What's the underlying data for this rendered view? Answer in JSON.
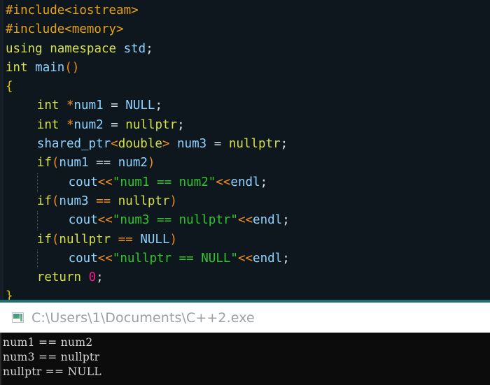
{
  "editor": {
    "background": "#0f171e",
    "lines": [
      {
        "indent": 0,
        "guide": false,
        "tokens": [
          {
            "t": "#include<iostream>",
            "c": "c-pre"
          }
        ]
      },
      {
        "indent": 0,
        "guide": false,
        "tokens": [
          {
            "t": "#include<memory>",
            "c": "c-pre"
          }
        ]
      },
      {
        "indent": 0,
        "guide": false,
        "tokens": [
          {
            "t": "using",
            "c": "c-kw"
          },
          {
            "t": " ",
            "c": "c-punc"
          },
          {
            "t": "namespace",
            "c": "c-kw"
          },
          {
            "t": " ",
            "c": "c-punc"
          },
          {
            "t": "std",
            "c": "c-id"
          },
          {
            "t": ";",
            "c": "c-punc"
          }
        ]
      },
      {
        "indent": 0,
        "guide": false,
        "tokens": [
          {
            "t": "int",
            "c": "c-kw"
          },
          {
            "t": " ",
            "c": "c-punc"
          },
          {
            "t": "main",
            "c": "c-id"
          },
          {
            "t": "()",
            "c": "c-op"
          }
        ]
      },
      {
        "indent": 0,
        "guide": false,
        "tokens": [
          {
            "t": "{",
            "c": "c-brace"
          }
        ]
      },
      {
        "indent": 4,
        "guide": false,
        "tokens": [
          {
            "t": "int",
            "c": "c-kw"
          },
          {
            "t": " ",
            "c": "c-punc"
          },
          {
            "t": "*",
            "c": "c-op"
          },
          {
            "t": "num1",
            "c": "c-id"
          },
          {
            "t": " ",
            "c": "c-punc"
          },
          {
            "t": "=",
            "c": "c-punc"
          },
          {
            "t": " ",
            "c": "c-punc"
          },
          {
            "t": "NULL",
            "c": "c-id"
          },
          {
            "t": ";",
            "c": "c-punc"
          }
        ]
      },
      {
        "indent": 4,
        "guide": false,
        "tokens": [
          {
            "t": "int",
            "c": "c-kw"
          },
          {
            "t": " ",
            "c": "c-punc"
          },
          {
            "t": "*",
            "c": "c-op"
          },
          {
            "t": "num2",
            "c": "c-id"
          },
          {
            "t": " ",
            "c": "c-punc"
          },
          {
            "t": "=",
            "c": "c-punc"
          },
          {
            "t": " ",
            "c": "c-punc"
          },
          {
            "t": "nullptr",
            "c": "c-kw"
          },
          {
            "t": ";",
            "c": "c-punc"
          }
        ]
      },
      {
        "indent": 4,
        "guide": false,
        "tokens": [
          {
            "t": "shared_ptr",
            "c": "c-id"
          },
          {
            "t": "<",
            "c": "c-op"
          },
          {
            "t": "double",
            "c": "c-kw"
          },
          {
            "t": ">",
            "c": "c-op"
          },
          {
            "t": " ",
            "c": "c-punc"
          },
          {
            "t": "num3",
            "c": "c-id"
          },
          {
            "t": " ",
            "c": "c-punc"
          },
          {
            "t": "=",
            "c": "c-punc"
          },
          {
            "t": " ",
            "c": "c-punc"
          },
          {
            "t": "nullptr",
            "c": "c-kw"
          },
          {
            "t": ";",
            "c": "c-punc"
          }
        ]
      },
      {
        "indent": 4,
        "guide": false,
        "tokens": [
          {
            "t": "if",
            "c": "c-kw"
          },
          {
            "t": "(",
            "c": "c-op"
          },
          {
            "t": "num1",
            "c": "c-id"
          },
          {
            "t": " ",
            "c": "c-punc"
          },
          {
            "t": "==",
            "c": "c-punc"
          },
          {
            "t": " ",
            "c": "c-punc"
          },
          {
            "t": "num2",
            "c": "c-id"
          },
          {
            "t": ")",
            "c": "c-op"
          }
        ]
      },
      {
        "indent": 8,
        "guide": true,
        "tokens": [
          {
            "t": "cout",
            "c": "c-id"
          },
          {
            "t": "<<",
            "c": "c-op"
          },
          {
            "t": "\"num1 == num2\"",
            "c": "c-str"
          },
          {
            "t": "<<",
            "c": "c-op"
          },
          {
            "t": "endl",
            "c": "c-id"
          },
          {
            "t": ";",
            "c": "c-punc"
          }
        ]
      },
      {
        "indent": 4,
        "guide": false,
        "tokens": [
          {
            "t": "if",
            "c": "c-kw"
          },
          {
            "t": "(",
            "c": "c-op"
          },
          {
            "t": "num3",
            "c": "c-id"
          },
          {
            "t": " ",
            "c": "c-punc"
          },
          {
            "t": "==",
            "c": "c-op"
          },
          {
            "t": " ",
            "c": "c-punc"
          },
          {
            "t": "nullptr",
            "c": "c-kw"
          },
          {
            "t": ")",
            "c": "c-op"
          }
        ]
      },
      {
        "indent": 8,
        "guide": true,
        "tokens": [
          {
            "t": "cout",
            "c": "c-id"
          },
          {
            "t": "<<",
            "c": "c-op"
          },
          {
            "t": "\"num3 == nullptr\"",
            "c": "c-str"
          },
          {
            "t": "<<",
            "c": "c-op"
          },
          {
            "t": "endl",
            "c": "c-id"
          },
          {
            "t": ";",
            "c": "c-punc"
          }
        ]
      },
      {
        "indent": 4,
        "guide": false,
        "tokens": [
          {
            "t": "if",
            "c": "c-kw"
          },
          {
            "t": "(",
            "c": "c-op"
          },
          {
            "t": "nullptr",
            "c": "c-kw"
          },
          {
            "t": " ",
            "c": "c-punc"
          },
          {
            "t": "==",
            "c": "c-op"
          },
          {
            "t": " ",
            "c": "c-punc"
          },
          {
            "t": "NULL",
            "c": "c-id"
          },
          {
            "t": ")",
            "c": "c-op"
          }
        ]
      },
      {
        "indent": 8,
        "guide": true,
        "tokens": [
          {
            "t": "cout",
            "c": "c-id"
          },
          {
            "t": "<<",
            "c": "c-op"
          },
          {
            "t": "\"nullptr == NULL\"",
            "c": "c-str"
          },
          {
            "t": "<<",
            "c": "c-op"
          },
          {
            "t": "endl",
            "c": "c-id"
          },
          {
            "t": ";",
            "c": "c-punc"
          }
        ]
      },
      {
        "indent": 4,
        "guide": false,
        "tokens": [
          {
            "t": "return",
            "c": "c-kw"
          },
          {
            "t": " ",
            "c": "c-punc"
          },
          {
            "t": "0",
            "c": "c-num"
          },
          {
            "t": ";",
            "c": "c-punc"
          }
        ]
      },
      {
        "indent": 0,
        "guide": false,
        "tokens": [
          {
            "t": "}",
            "c": "c-brace"
          }
        ]
      }
    ]
  },
  "console": {
    "title": "C:\\Users\\1\\Documents\\C++2.exe",
    "icon": "console-window-icon",
    "titlebar_background": "#ffffff",
    "titlebar_text_color": "#9aa0a6",
    "body_background": "#0c0c0c",
    "body_text_color": "#d6d6d6",
    "output": [
      "num1 == num2",
      "num3 == nullptr",
      "nullptr == NULL"
    ]
  },
  "separator": {
    "color": "#1c6e71"
  }
}
